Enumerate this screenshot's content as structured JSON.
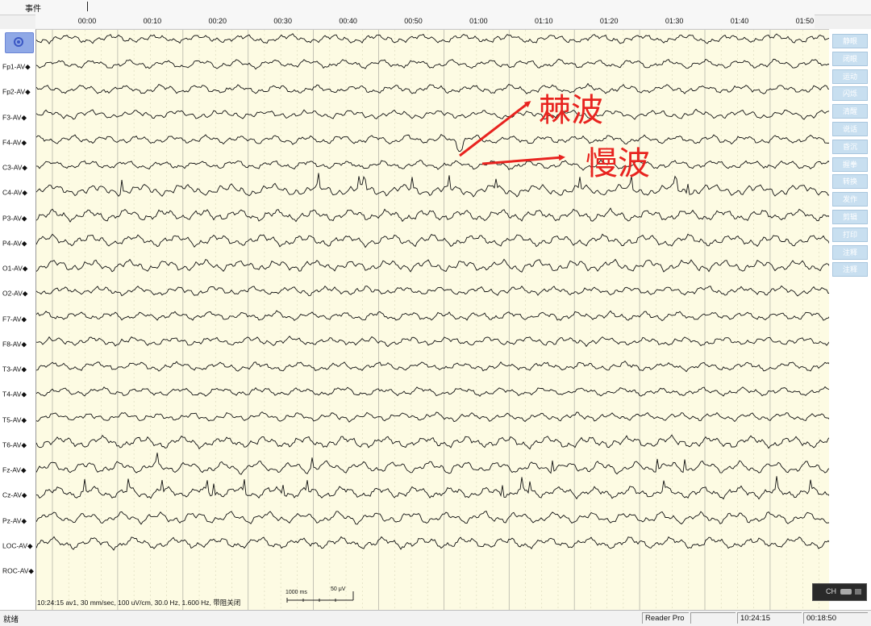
{
  "topbar": {
    "events_label": "事件"
  },
  "time_ticks": [
    "00:00",
    "00:10",
    "00:20",
    "00:30",
    "00:40",
    "00:50",
    "01:00",
    "01:10",
    "01:20",
    "01:30",
    "01:40",
    "01:50"
  ],
  "channels": [
    "Fp1-AV",
    "Fp2-AV",
    "F3-AV",
    "F4-AV",
    "C3-AV",
    "C4-AV",
    "P3-AV",
    "P4-AV",
    "O1-AV",
    "O2-AV",
    "F7-AV",
    "F8-AV",
    "T3-AV",
    "T4-AV",
    "T5-AV",
    "T6-AV",
    "Fz-AV",
    "Cz-AV",
    "Pz-AV",
    "LOC-AV",
    "ROC-AV"
  ],
  "side_buttons": [
    "静眼",
    "闭眼",
    "运动",
    "闪烁",
    "清醒",
    "说话",
    "昏沉",
    "握拳",
    "转换",
    "发作",
    "剪辑",
    "打印",
    "注释",
    "注释"
  ],
  "annotations": {
    "spike": "棘波",
    "slow": "慢波"
  },
  "footer": {
    "info": "10:24:15 av1, 30 mm/sec, 100 uV/cm, 30.0 Hz, 1.600 Hz, 带阻关闭",
    "scale_time": "1000 ms",
    "scale_amp": "50 μV"
  },
  "ch_box": {
    "label": "CH"
  },
  "status": {
    "ready": "就绪",
    "app": "Reader Pro",
    "time": "10:24:15",
    "elapsed": "00:18:50"
  },
  "colors": {
    "annotation": "#e8231f",
    "plot_bg": "#fdfbe3",
    "side_button": "#c8dff0"
  }
}
